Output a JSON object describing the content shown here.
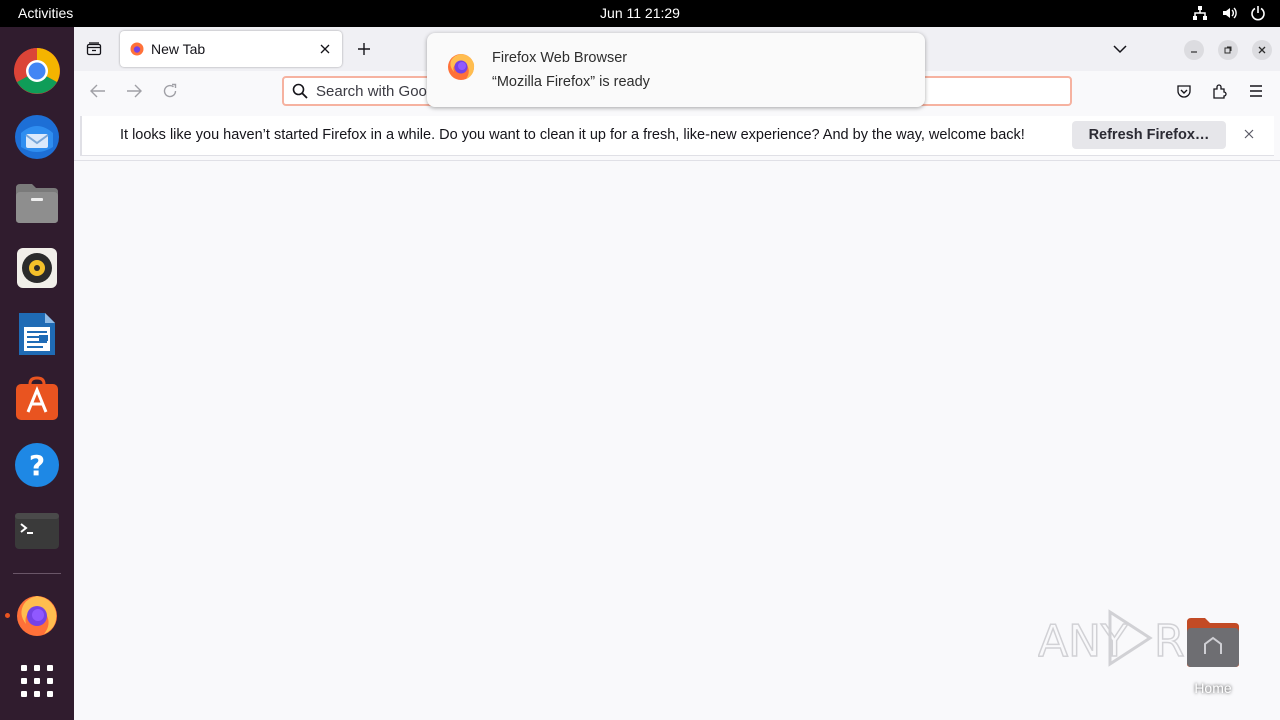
{
  "topbar": {
    "activities": "Activities",
    "clock": "Jun 11  21:29",
    "icons": [
      "network-icon",
      "volume-icon",
      "power-icon"
    ]
  },
  "dock": {
    "apps": [
      "Google Chrome",
      "Thunderbird",
      "Files",
      "Rhythmbox",
      "LibreOffice Writer",
      "Ubuntu Software",
      "Help",
      "Terminal",
      "Firefox",
      "Show Applications"
    ],
    "running_accent": "#e95420"
  },
  "browser": {
    "tab": {
      "title": "New Tab"
    },
    "urlbar": {
      "placeholder": "Search with Goo"
    },
    "notification": {
      "message": "It looks like you haven’t started Firefox in a while. Do you want to clean it up for a fresh, like-new experience? And by the way, welcome back!",
      "button": "Refresh Firefox…"
    }
  },
  "gnome_notification": {
    "title": "Firefox Web Browser",
    "body": "“Mozilla Firefox” is ready"
  },
  "desktop": {
    "watermark": "ANY RUN",
    "home_label": "Home"
  }
}
